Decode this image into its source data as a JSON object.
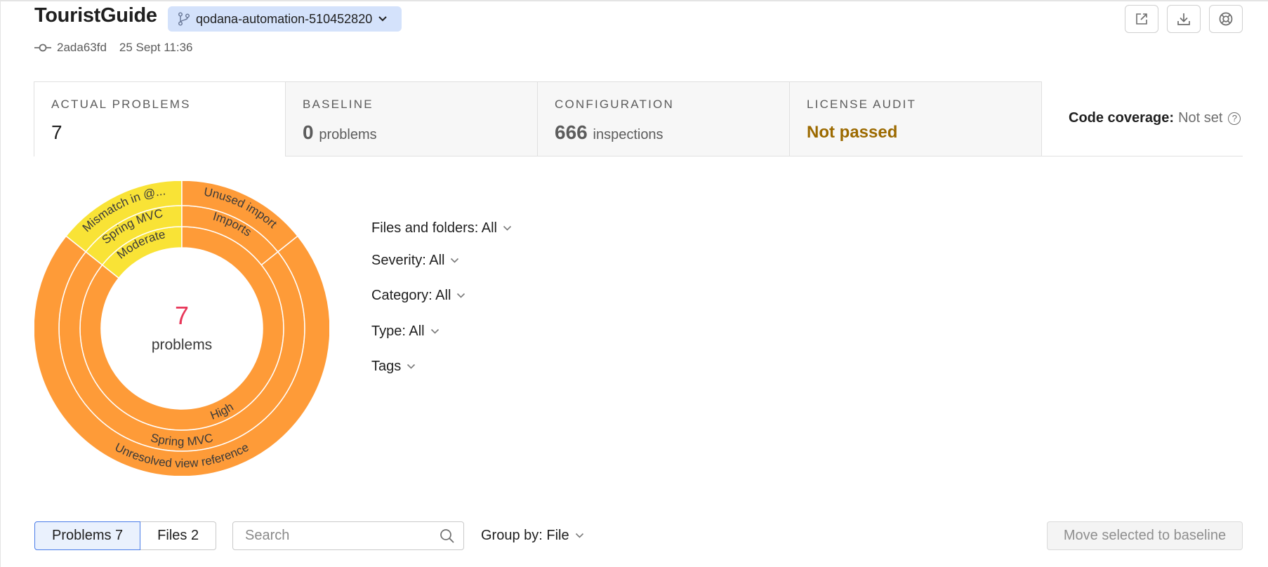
{
  "header": {
    "project_name": "TouristGuide",
    "branch": "qodana-automation-510452820",
    "commit_hash": "2ada63fd",
    "commit_date": "25 Sept 11:36",
    "icons": [
      "open-external-icon",
      "download-icon",
      "help-lifebuoy-icon"
    ]
  },
  "tabs": [
    {
      "label": "ACTUAL PROBLEMS",
      "value": "7",
      "unit": ""
    },
    {
      "label": "BASELINE",
      "value": "0",
      "unit": "problems"
    },
    {
      "label": "CONFIGURATION",
      "value": "666",
      "unit": "inspections"
    },
    {
      "label": "LICENSE AUDIT",
      "value": "Not passed",
      "unit": ""
    }
  ],
  "coverage": {
    "label": "Code coverage:",
    "value": "Not set",
    "help_glyph": "?"
  },
  "summary": {
    "count": "7",
    "label": "problems"
  },
  "sunburst": {
    "inner": [
      {
        "label": "Moderate",
        "count": 1,
        "color": "#f9e336"
      },
      {
        "label": "High",
        "count": 6,
        "color": "#fe9b38"
      }
    ],
    "middle": [
      {
        "label": "Spring MVC",
        "count": 1,
        "color": "#f9e336"
      },
      {
        "label": "Imports",
        "count": 1,
        "color": "#fe9b38"
      },
      {
        "label": "Spring MVC",
        "count": 5,
        "color": "#fe9b38"
      }
    ],
    "outer": [
      {
        "label": "Mismatch in @...",
        "count": 1,
        "color": "#f9e336"
      },
      {
        "label": "Unused import",
        "count": 1,
        "color": "#fe9b38"
      },
      {
        "label": "Unresolved view reference",
        "count": 5,
        "color": "#fe9b38"
      }
    ]
  },
  "filters": [
    {
      "label": "Files and folders: All"
    },
    {
      "label": "Severity: All"
    },
    {
      "label": "Category: All"
    },
    {
      "label": "Type: All"
    },
    {
      "label": "Tags"
    }
  ],
  "toolbar": {
    "problems_tab": "Problems 7",
    "files_tab": "Files 2",
    "search_placeholder": "Search",
    "group_by": "Group by: File",
    "move_button": "Move selected to baseline"
  },
  "colors": {
    "accent": "#4a7ce8",
    "count_red": "#e8385a",
    "warning": "#9c6a00",
    "orange": "#fe9b38",
    "yellow": "#f9e336"
  }
}
